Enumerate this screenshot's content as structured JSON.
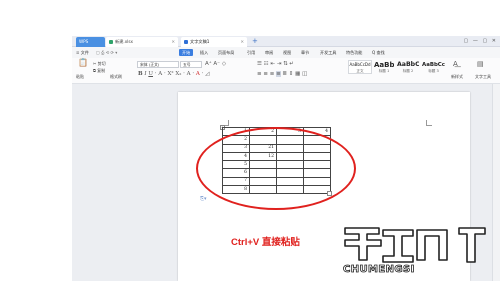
{
  "tabs": {
    "wps": "WPS",
    "sheet": "新建.xlsx",
    "doc": "文字文稿1",
    "new_tab": "+"
  },
  "titlebar_right": [
    "▢",
    "—",
    "▢",
    "✕"
  ],
  "menu": {
    "file": "≡ 文件",
    "items": [
      "开始",
      "插入",
      "页面布局",
      "引用",
      "审阅",
      "视图",
      "章节",
      "开发工具",
      "特色功能"
    ],
    "start_index": 0,
    "search": "Q 查找"
  },
  "ribbon": {
    "paste": "粘贴",
    "cut": "剪切",
    "copy": "复制",
    "format_painter": "格式刷",
    "font_name": "宋体 (正文)",
    "font_size": "五号",
    "styles": [
      {
        "sample": "AaBbCcDd",
        "name": "正文"
      },
      {
        "sample": "AaBb",
        "name": "标题 1"
      },
      {
        "sample": "AaBbC",
        "name": "标题 2"
      },
      {
        "sample": "AaBbCc",
        "name": "标题 3"
      }
    ],
    "new_style": "新样式",
    "text_tools": "文字工具"
  },
  "table": {
    "rows": [
      [
        "1",
        "2",
        "3",
        "4"
      ],
      [
        "2",
        "",
        "",
        ""
      ],
      [
        "3",
        "21",
        "",
        ""
      ],
      [
        "4",
        "12",
        "",
        ""
      ],
      [
        "5",
        "",
        "",
        ""
      ],
      [
        "6",
        "",
        "",
        ""
      ],
      [
        "7",
        "",
        "",
        ""
      ],
      [
        "8",
        "",
        "",
        ""
      ]
    ]
  },
  "caption": "Ctrl+V   直接粘贴",
  "watermark": {
    "name": "CHUMENGSI"
  },
  "colors": {
    "annotation_red": "#e0211e",
    "accent_blue": "#3b7ee0"
  }
}
